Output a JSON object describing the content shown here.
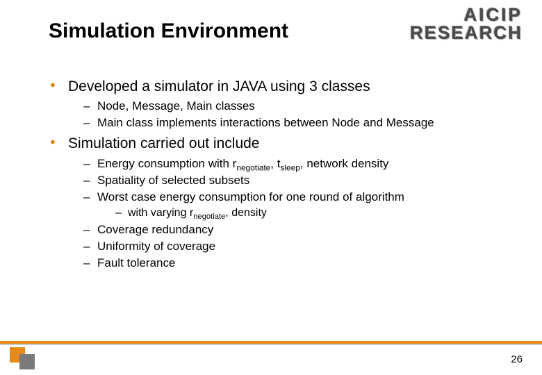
{
  "logo": {
    "line1": "AICIP",
    "line2": "RESEARCH"
  },
  "title": "Simulation Environment",
  "bullets": [
    {
      "text": "Developed a simulator in JAVA using 3 classes",
      "sub": [
        {
          "text": "Node, Message, Main classes"
        },
        {
          "text": "Main class implements interactions between Node and Message"
        }
      ]
    },
    {
      "text": "Simulation carried out include",
      "sub": [
        {
          "parts": [
            {
              "t": "Energy consumption with r"
            },
            {
              "t": "negotiate",
              "sub": true
            },
            {
              "t": ", t"
            },
            {
              "t": "sleep",
              "sub": true
            },
            {
              "t": ", network density"
            }
          ]
        },
        {
          "text": "Spatiality of selected subsets"
        },
        {
          "text": "Worst case energy consumption for one round of algorithm",
          "sub": [
            {
              "parts": [
                {
                  "t": "with varying r"
                },
                {
                  "t": "negotiate",
                  "sub": true
                },
                {
                  "t": ", density"
                }
              ]
            }
          ]
        },
        {
          "text": "Coverage redundancy"
        },
        {
          "text": "Uniformity of coverage"
        },
        {
          "text": "Fault tolerance"
        }
      ]
    }
  ],
  "page_number": "26"
}
